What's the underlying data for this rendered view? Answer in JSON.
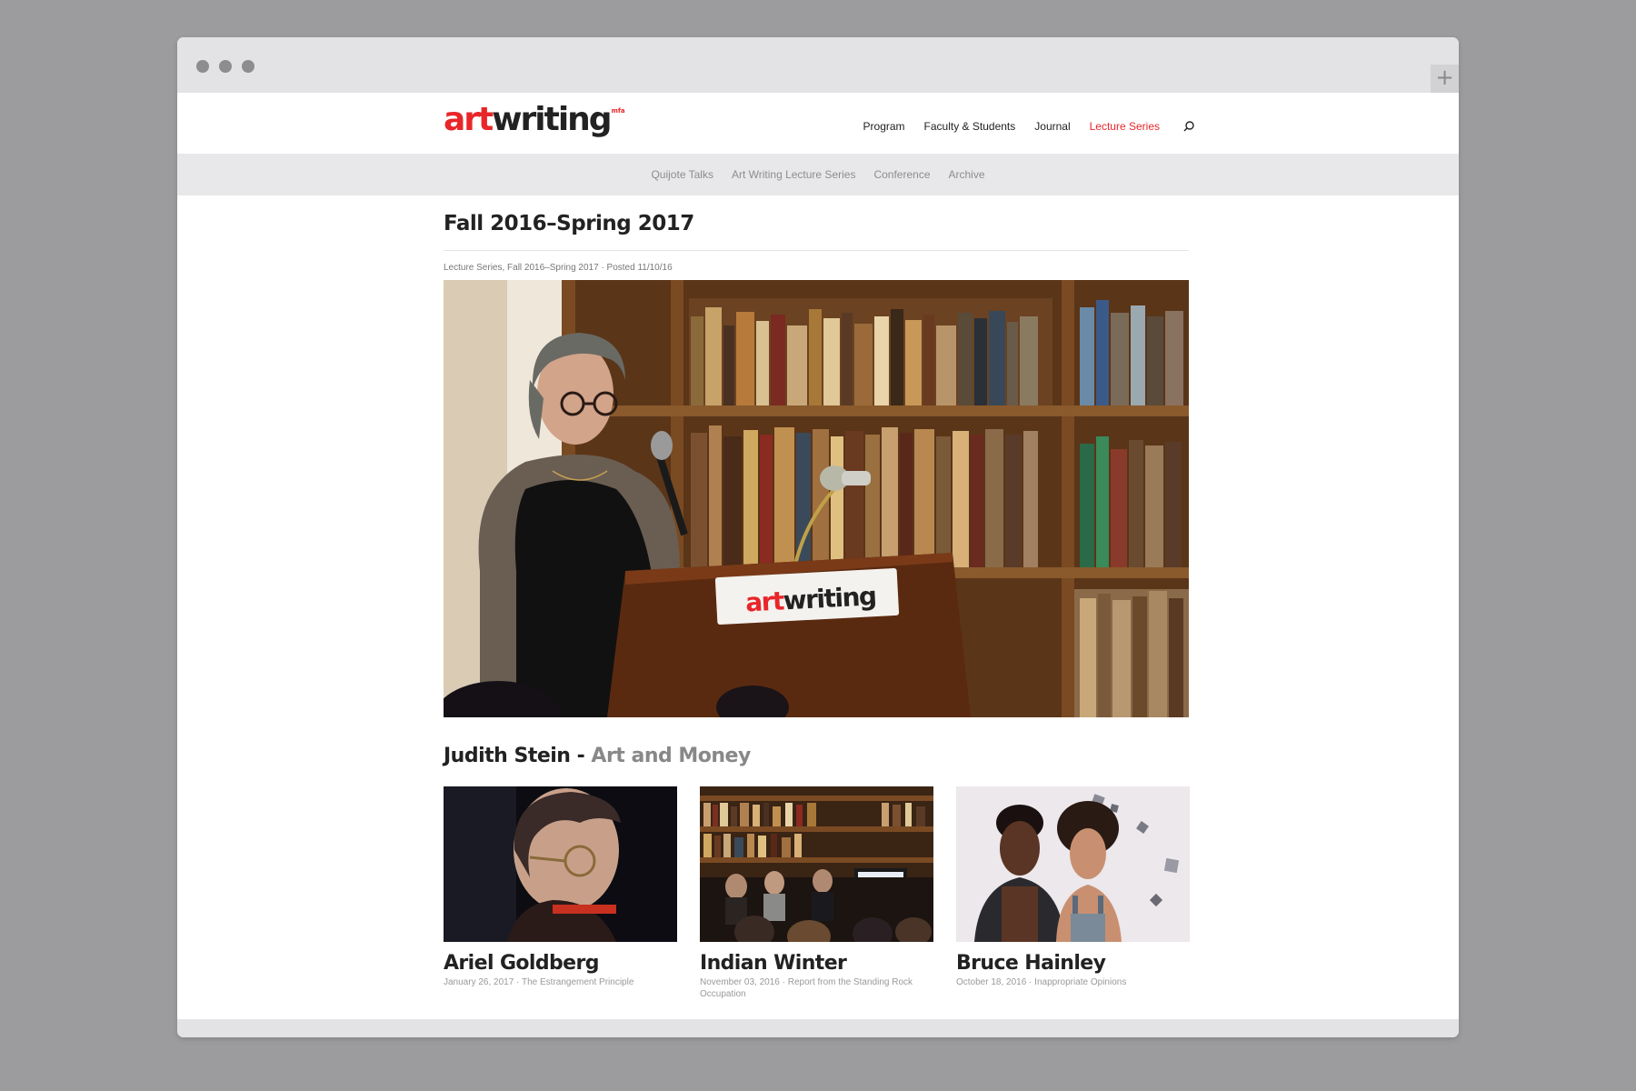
{
  "browser": {
    "new_tab_symbol": "+"
  },
  "site": {
    "logo_art": "art",
    "logo_writing": "writing",
    "logo_tag": "mfa"
  },
  "nav": {
    "items": [
      {
        "label": "Program"
      },
      {
        "label": "Faculty & Students"
      },
      {
        "label": "Journal"
      },
      {
        "label": "Lecture Series",
        "active": true
      }
    ]
  },
  "subnav": {
    "items": [
      {
        "label": "Quijote Talks"
      },
      {
        "label": "Art Writing Lecture Series"
      },
      {
        "label": "Conference"
      },
      {
        "label": "Archive"
      }
    ]
  },
  "post": {
    "title": "Fall 2016–Spring 2017",
    "meta": "Lecture Series, Fall 2016–Spring 2017 · Posted 11/10/16",
    "podium_logo_art": "art",
    "podium_logo_writing": "writing"
  },
  "feature": {
    "name": "Judith Stein",
    "separator": " - ",
    "topic": "Art and Money"
  },
  "cards": [
    {
      "title": "Ariel Goldberg",
      "meta": "January 26, 2017 · The Estrangement Principle"
    },
    {
      "title": "Indian Winter",
      "meta": "November 03, 2016 · Report from the Standing Rock Occupation"
    },
    {
      "title": "Bruce Hainley",
      "meta": "October 18, 2016 · Inappropriate Opinions"
    }
  ],
  "colors": {
    "accent": "#e8262a",
    "background": "#9c9c9e",
    "chrome": "#e3e3e5",
    "subnav_bg": "#e8e8ea"
  }
}
